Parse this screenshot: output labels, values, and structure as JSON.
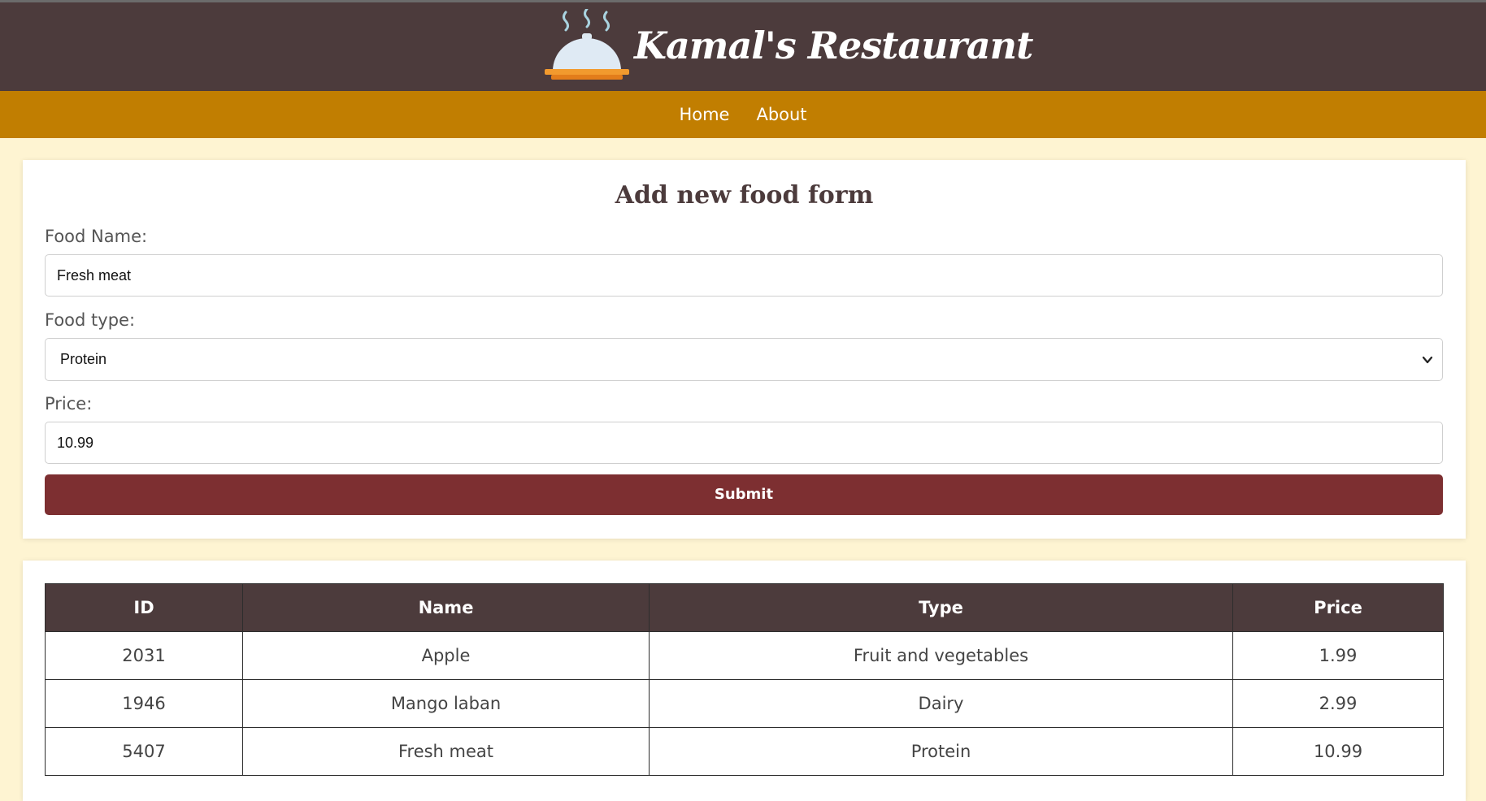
{
  "header": {
    "brand": "Kamal's Restaurant",
    "logo_icon": "cloche-serving-dish-icon",
    "colors": {
      "header_bg": "#4c3b3c",
      "nav_bg": "#c17e01",
      "page_bg": "#fef4d2",
      "submit_bg": "#7d2f31"
    }
  },
  "nav": {
    "items": [
      {
        "label": "Home"
      },
      {
        "label": "About"
      }
    ]
  },
  "form": {
    "title": "Add new food form",
    "food_name": {
      "label": "Food Name:",
      "value": "Fresh meat"
    },
    "food_type": {
      "label": "Food type:",
      "selected": "Protein",
      "icon": "chevron-down-icon"
    },
    "price": {
      "label": "Price:",
      "value": "10.99"
    },
    "submit_label": "Submit"
  },
  "table": {
    "columns": [
      "ID",
      "Name",
      "Type",
      "Price"
    ],
    "rows": [
      [
        "2031",
        "Apple",
        "Fruit and vegetables",
        "1.99"
      ],
      [
        "1946",
        "Mango laban",
        "Dairy",
        "2.99"
      ],
      [
        "5407",
        "Fresh meat",
        "Protein",
        "10.99"
      ]
    ]
  }
}
